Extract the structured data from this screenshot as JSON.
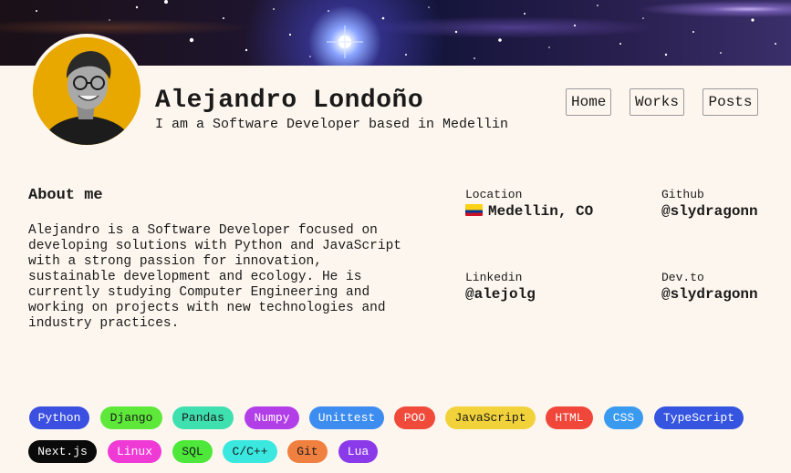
{
  "header": {
    "name": "Alejandro Londoño",
    "tagline": "I am a Software Developer based in Medellin"
  },
  "nav": {
    "home": "Home",
    "works": "Works",
    "posts": "Posts"
  },
  "about": {
    "title": "About me",
    "text": "Alejandro is a Software Developer focused on developing solutions with Python and JavaScript with a strong passion for innovation, sustainable development and ecology. He is currently studying Computer Engineering and working on projects with new technologies and industry practices."
  },
  "info": {
    "location": {
      "label": "Location",
      "value": "Medellin, CO",
      "flag_icon": "colombia-flag-icon"
    },
    "github": {
      "label": "Github",
      "value": "@slydragonn"
    },
    "linkedin": {
      "label": "Linkedin",
      "value": "@alejolg"
    },
    "devto": {
      "label": "Dev.to",
      "value": "@slydragonn"
    }
  },
  "tags": [
    {
      "label": "Python",
      "bg": "#3b4fe0",
      "fg": "#ffffff"
    },
    {
      "label": "Django",
      "bg": "#5ee83a",
      "fg": "#1a1a1a"
    },
    {
      "label": "Pandas",
      "bg": "#3fe0b0",
      "fg": "#1a1a1a"
    },
    {
      "label": "Numpy",
      "bg": "#b23ee8",
      "fg": "#ffffff"
    },
    {
      "label": "Unittest",
      "bg": "#3d8cf0",
      "fg": "#ffffff"
    },
    {
      "label": "POO",
      "bg": "#f04a3a",
      "fg": "#ffffff"
    },
    {
      "label": "JavaScript",
      "bg": "#f2d23a",
      "fg": "#1a1a1a"
    },
    {
      "label": "HTML",
      "bg": "#f0473a",
      "fg": "#ffffff"
    },
    {
      "label": "CSS",
      "bg": "#3a9af0",
      "fg": "#ffffff"
    },
    {
      "label": "TypeScript",
      "bg": "#3554e0",
      "fg": "#ffffff"
    },
    {
      "label": "Next.js",
      "bg": "#0a0a0a",
      "fg": "#ffffff"
    },
    {
      "label": "Linux",
      "bg": "#f03ad6",
      "fg": "#ffffff"
    },
    {
      "label": "SQL",
      "bg": "#4de83a",
      "fg": "#1a1a1a"
    },
    {
      "label": "C/C++",
      "bg": "#3ae8e0",
      "fg": "#1a1a1a"
    },
    {
      "label": "Git",
      "bg": "#f08040",
      "fg": "#1a1a1a"
    },
    {
      "label": "Lua",
      "bg": "#8a3ae8",
      "fg": "#ffffff"
    }
  ]
}
